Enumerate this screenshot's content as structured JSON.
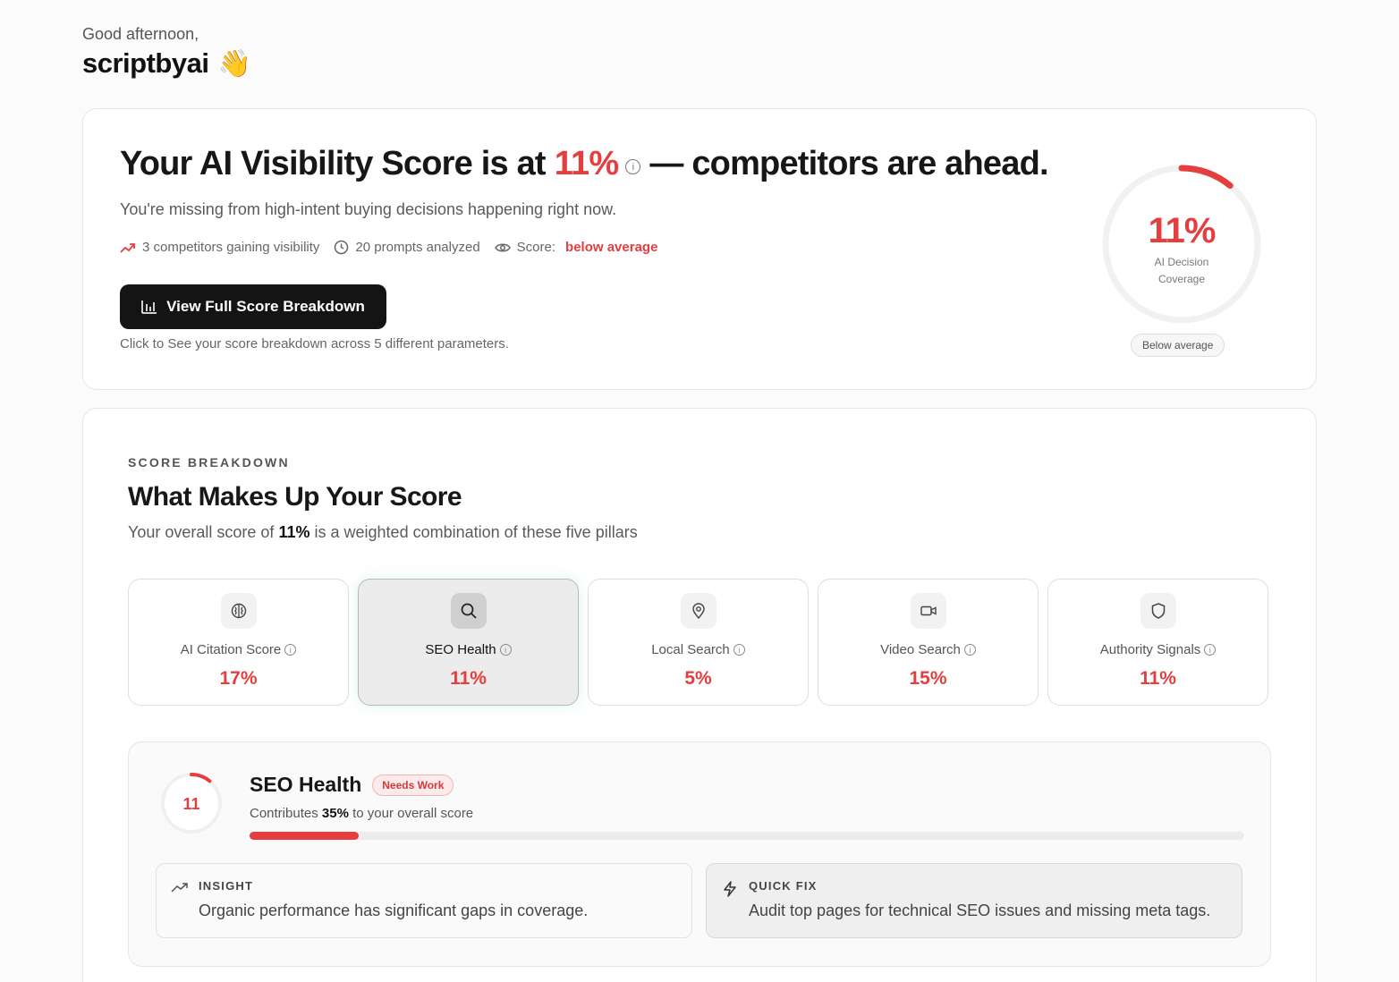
{
  "greeting": {
    "salutation": "Good afternoon,",
    "username": "scriptbyai",
    "emoji": "👋"
  },
  "hero": {
    "title_prefix": "Your AI Visibility Score is at",
    "title_score": "11%",
    "title_suffix": "— competitors are ahead.",
    "lead": "You're missing from high-intent buying decisions happening right now.",
    "meta": {
      "competitors": "3 competitors gaining visibility",
      "prompts": "20 prompts analyzed",
      "score_label": "Score:",
      "score_value": "below average"
    },
    "cta_label": "View Full Score Breakdown",
    "hint": "Click to See your score breakdown across 5 different parameters.",
    "gauge": {
      "value": "11%",
      "fraction": 0.11,
      "label_line1": "AI Decision",
      "label_line2": "Coverage",
      "status": "Below average"
    }
  },
  "breakdown": {
    "eyebrow": "SCORE BREAKDOWN",
    "title": "What Makes Up Your Score",
    "desc_prefix": "Your overall score of",
    "desc_score": "11%",
    "desc_suffix": "is a weighted combination of these five pillars",
    "pillars": [
      {
        "name": "AI Citation Score",
        "value": "17%",
        "icon": "brain-icon"
      },
      {
        "name": "SEO Health",
        "value": "11%",
        "icon": "search-icon"
      },
      {
        "name": "Local Search",
        "value": "5%",
        "icon": "map-pin-icon"
      },
      {
        "name": "Video Search",
        "value": "15%",
        "icon": "video-icon"
      },
      {
        "name": "Authority Signals",
        "value": "11%",
        "icon": "shield-icon"
      }
    ],
    "detail": {
      "score": "11",
      "score_fraction": 0.11,
      "title": "SEO Health",
      "badge": "Needs Work",
      "contrib_prefix": "Contributes",
      "contrib_value": "35%",
      "contrib_suffix": "to your overall score",
      "progress_fraction": 0.11,
      "insight_label": "INSIGHT",
      "insight_text": "Organic performance has significant gaps in coverage.",
      "fix_label": "QUICK FIX",
      "fix_text": "Audit top pages for technical SEO issues and missing meta tags."
    }
  },
  "colors": {
    "accent": "#e53e3e",
    "dark": "#141414"
  }
}
